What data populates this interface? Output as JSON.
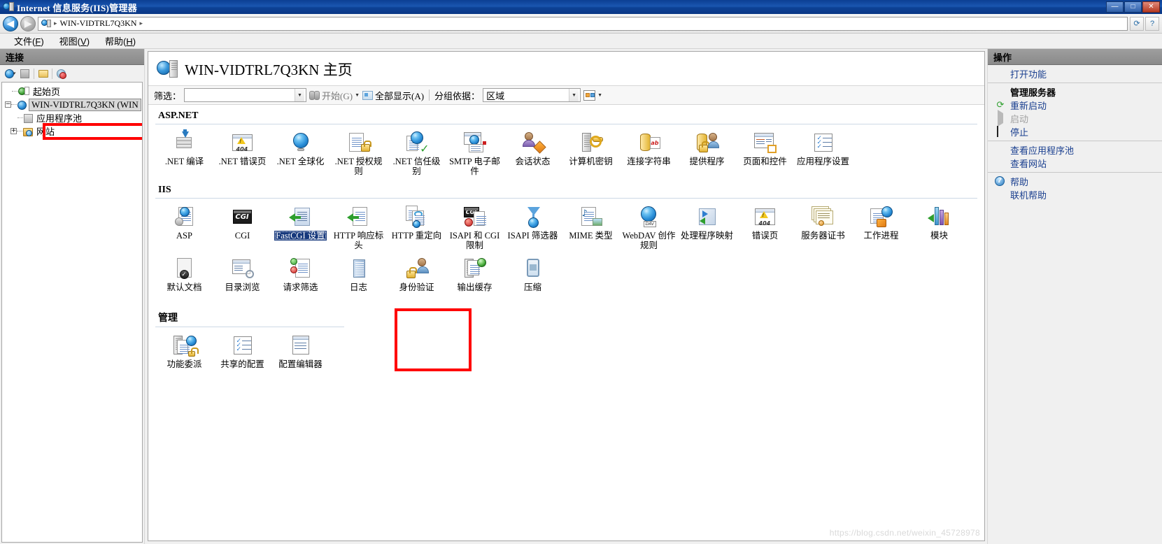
{
  "window": {
    "title": "Internet 信息服务(IIS)管理器",
    "icon": "iis-server-icon",
    "buttons": [
      {
        "name": "minimize-button",
        "glyph": "—"
      },
      {
        "name": "maximize-button",
        "glyph": "□"
      },
      {
        "name": "close-button",
        "glyph": "✕"
      }
    ]
  },
  "addressbar": {
    "back_label": "◀",
    "forward_label": "▶",
    "icon": "server-globe-icon",
    "path": "WIN-VIDTRL7Q3KN",
    "separator": "▸",
    "right_buttons": [
      {
        "name": "refresh-button",
        "glyph": "⟳"
      },
      {
        "name": "help-button",
        "glyph": "?"
      }
    ]
  },
  "menubar": {
    "items": [
      {
        "label": "文件",
        "accel": "F"
      },
      {
        "label": "视图",
        "accel": "V"
      },
      {
        "label": "帮助",
        "accel": "H"
      }
    ]
  },
  "connections": {
    "header": "连接",
    "toolbar": [
      {
        "name": "connect-to-icon",
        "label": "连接到"
      },
      {
        "name": "save-connections-icon",
        "label": "保存连接"
      },
      {
        "name": "open-connection-icon",
        "label": "打开连接"
      },
      {
        "name": "disconnect-icon",
        "label": "断开连接"
      }
    ],
    "tree": [
      {
        "label": "起始页",
        "icon": "start-page-icon",
        "level": 0,
        "expander": "",
        "selected": false
      },
      {
        "label": "WIN-VIDTRL7Q3KN (WIN",
        "icon": "server-icon",
        "level": 0,
        "expander": "−",
        "selected": true
      },
      {
        "label": "应用程序池",
        "icon": "app-pools-icon",
        "level": 1,
        "expander": "",
        "selected": false
      },
      {
        "label": "网站",
        "icon": "sites-icon",
        "level": 1,
        "expander": "+",
        "selected": false
      }
    ]
  },
  "page": {
    "title": "WIN-VIDTRL7Q3KN 主页",
    "icon": "server-home-icon",
    "watermark": "https://blog.csdn.net/weixin_45728978"
  },
  "filterbar": {
    "filter_label": "筛选：",
    "filter_value": "",
    "go_label": "开始(G)",
    "go_icon": "binoculars-icon",
    "showall_label": "全部显示(A)",
    "showall_icon": "show-all-icon",
    "groupby_label": "分组依据：",
    "groupby_value": "区域",
    "view_icon": "view-mode-icon"
  },
  "sections": [
    {
      "title": "ASP.NET",
      "features": [
        {
          "label": ".NET 编译",
          "icon": "net-compilation-icon",
          "art": "compilation"
        },
        {
          "label": ".NET 错误页",
          "icon": "net-error-pages-icon",
          "art": "error404"
        },
        {
          "label": ".NET 全球化",
          "icon": "net-globalization-icon",
          "art": "globe"
        },
        {
          "label": ".NET 授权规则",
          "icon": "net-authorization-rules-icon",
          "art": "doclock"
        },
        {
          "label": ".NET 信任级别",
          "icon": "net-trust-levels-icon",
          "art": "globecheck"
        },
        {
          "label": "SMTP 电子邮件",
          "icon": "smtp-email-icon",
          "art": "smtp"
        },
        {
          "label": "会话状态",
          "icon": "session-state-icon",
          "art": "person-diamond"
        },
        {
          "label": "计算机密钥",
          "icon": "machine-key-icon",
          "art": "server-key"
        },
        {
          "label": "连接字符串",
          "icon": "connection-strings-icon",
          "art": "cylinder-ab"
        },
        {
          "label": "提供程序",
          "icon": "providers-icon",
          "art": "cylinder-person"
        },
        {
          "label": "页面和控件",
          "icon": "pages-and-controls-icon",
          "art": "win-controls"
        },
        {
          "label": "应用程序设置",
          "icon": "application-settings-icon",
          "art": "checklist"
        }
      ]
    },
    {
      "title": "IIS",
      "features": [
        {
          "label": "ASP",
          "icon": "asp-icon",
          "art": "asp"
        },
        {
          "label": "CGI",
          "icon": "cgi-icon",
          "art": "cgi"
        },
        {
          "label": "FastCGI 设置",
          "icon": "fastcgi-settings-icon",
          "art": "fastcgi",
          "selected": true,
          "highlight": true
        },
        {
          "label": "HTTP 响应标头",
          "icon": "http-response-headers-icon",
          "art": "http-headers"
        },
        {
          "label": "HTTP 重定向",
          "icon": "http-redirect-icon",
          "art": "http-redirect"
        },
        {
          "label": "ISAPI 和 CGI 限制",
          "icon": "isapi-cgi-restrictions-icon",
          "art": "isapi-cgi"
        },
        {
          "label": "ISAPI 筛选器",
          "icon": "isapi-filters-icon",
          "art": "funnel"
        },
        {
          "label": "MIME 类型",
          "icon": "mime-types-icon",
          "art": "mime"
        },
        {
          "label": "WebDAV 创作规则",
          "icon": "webdav-authoring-rules-icon",
          "art": "webdav"
        },
        {
          "label": "处理程序映射",
          "icon": "handler-mappings-icon",
          "art": "handler"
        },
        {
          "label": "错误页",
          "icon": "error-pages-icon",
          "art": "error404"
        },
        {
          "label": "服务器证书",
          "icon": "server-certificates-icon",
          "art": "certs"
        },
        {
          "label": "工作进程",
          "icon": "worker-processes-icon",
          "art": "worker"
        },
        {
          "label": "模块",
          "icon": "modules-icon",
          "art": "modules"
        },
        {
          "label": "默认文档",
          "icon": "default-document-icon",
          "art": "default-doc"
        },
        {
          "label": "目录浏览",
          "icon": "directory-browsing-icon",
          "art": "dir-browse"
        },
        {
          "label": "请求筛选",
          "icon": "request-filtering-icon",
          "art": "req-filter"
        },
        {
          "label": "日志",
          "icon": "logging-icon",
          "art": "notebook"
        },
        {
          "label": "身份验证",
          "icon": "authentication-icon",
          "art": "auth"
        },
        {
          "label": "输出缓存",
          "icon": "output-caching-icon",
          "art": "output-cache"
        },
        {
          "label": "压缩",
          "icon": "compression-icon",
          "art": "compression"
        }
      ]
    },
    {
      "title": "管理",
      "features": [
        {
          "label": "功能委派",
          "icon": "feature-delegation-icon",
          "art": "delegation"
        },
        {
          "label": "共享的配置",
          "icon": "shared-configuration-icon",
          "art": "checklist"
        },
        {
          "label": "配置编辑器",
          "icon": "configuration-editor-icon",
          "art": "config-editor"
        }
      ]
    }
  ],
  "actions": {
    "header": "操作",
    "groups": [
      {
        "items": [
          {
            "label": "打开功能",
            "icon": "",
            "state": "link"
          }
        ]
      },
      {
        "items": [
          {
            "label": "管理服务器",
            "icon": "",
            "state": "header"
          },
          {
            "label": "重新启动",
            "icon": "restart-icon",
            "state": "link"
          },
          {
            "label": "启动",
            "icon": "start-icon",
            "state": "disabled"
          },
          {
            "label": "停止",
            "icon": "stop-icon",
            "state": "link"
          }
        ]
      },
      {
        "items": [
          {
            "label": "查看应用程序池",
            "icon": "",
            "state": "link"
          },
          {
            "label": "查看网站",
            "icon": "",
            "state": "link"
          }
        ]
      },
      {
        "items": [
          {
            "label": "帮助",
            "icon": "help-icon",
            "state": "link"
          },
          {
            "label": "联机帮助",
            "icon": "",
            "state": "link"
          }
        ]
      }
    ]
  },
  "colors": {
    "title_bar": "#0d4296",
    "accent_link": "#1a3f8f",
    "selection": "#16387c",
    "annotation": "#ff0000"
  }
}
